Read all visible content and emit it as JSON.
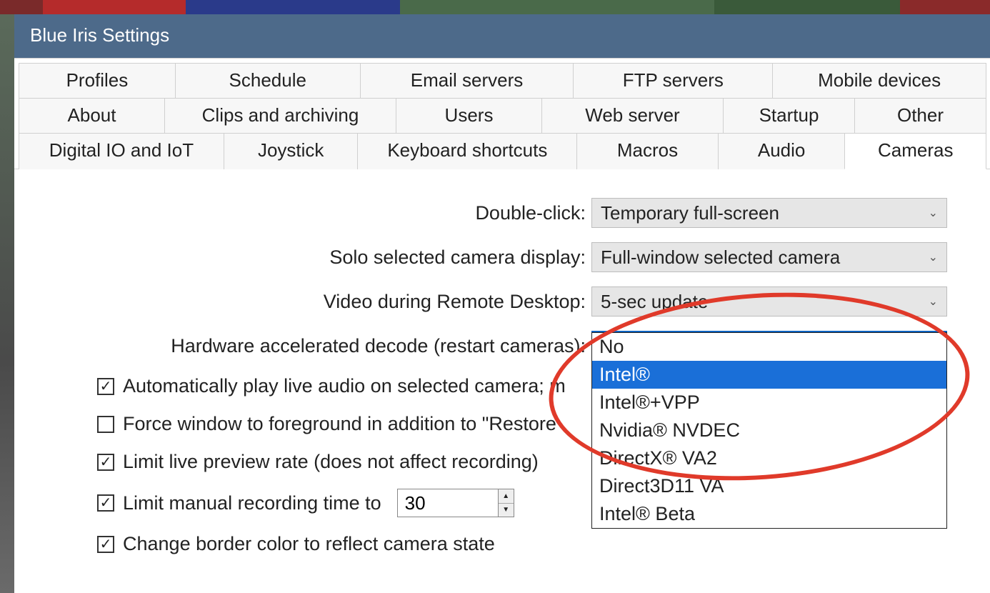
{
  "window": {
    "title": "Blue Iris Settings"
  },
  "tabs": {
    "row1": [
      "Profiles",
      "Schedule",
      "Email servers",
      "FTP servers",
      "Mobile devices"
    ],
    "row2": [
      "About",
      "Clips and archiving",
      "Users",
      "Web server",
      "Startup",
      "Other"
    ],
    "row3": [
      "Digital IO and IoT",
      "Joystick",
      "Keyboard shortcuts",
      "Macros",
      "Audio",
      "Cameras"
    ],
    "active": "Cameras"
  },
  "labels": {
    "double_click": "Double-click:",
    "solo": "Solo selected camera display:",
    "remote": "Video during Remote Desktop:",
    "hw_decode": "Hardware accelerated decode (restart cameras):"
  },
  "combos": {
    "double_click": "Temporary full-screen",
    "solo": "Full-window selected camera",
    "remote": "5-sec update",
    "hw_decode": "Intel®"
  },
  "hw_options": [
    "No",
    "Intel®",
    "Intel®+VPP",
    "Nvidia® NVDEC",
    "DirectX® VA2",
    "Direct3D11 VA",
    "Intel® Beta"
  ],
  "hw_selected": "Intel®",
  "checks": {
    "auto_audio": {
      "checked": true,
      "label": "Automatically play live audio on selected camera; m"
    },
    "force_fg": {
      "checked": false,
      "label": "Force window to foreground in addition to \"Restore"
    },
    "limit_live": {
      "checked": true,
      "label": "Limit live preview rate (does not affect recording)"
    },
    "limit_rec": {
      "checked": true,
      "label": "Limit manual recording time to"
    },
    "border": {
      "checked": true,
      "label": "Change border color to reflect camera state"
    }
  },
  "limit_rec_value": "30"
}
